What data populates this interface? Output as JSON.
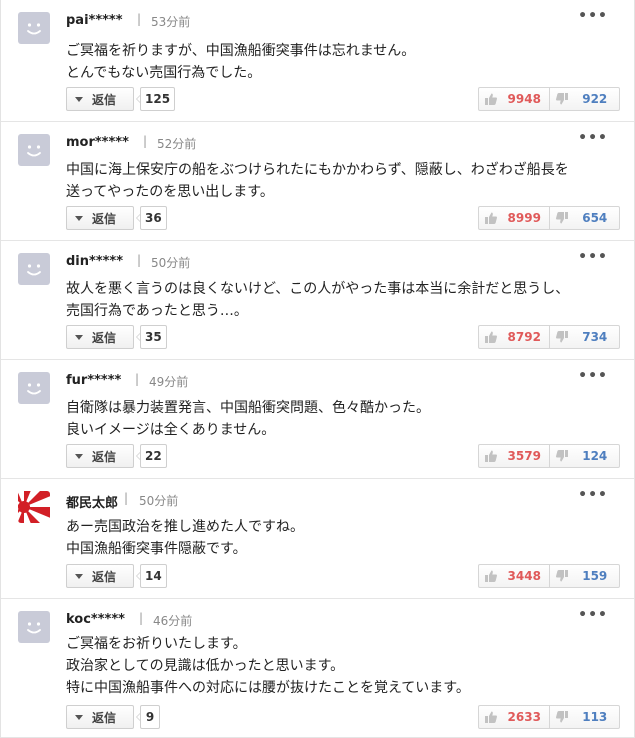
{
  "colors": {
    "like": "#e05a5a",
    "dislike": "#4f7fbf",
    "avatar_default": "#c9cbd8"
  },
  "ui": {
    "reply_label": "返信",
    "more_label": "•••",
    "separator": "|"
  },
  "comments": [
    {
      "username": "pai*****",
      "time": "53分前",
      "avatar": "default-face-icon",
      "lines": [
        "ご冥福を祈りますが、中国漁船衝突事件は忘れません。",
        "とんでもない売国行為でした。"
      ],
      "replies": "125",
      "likes": "9948",
      "dislikes": "922"
    },
    {
      "username": "mor*****",
      "time": "52分前",
      "avatar": "default-face-icon",
      "lines": [
        "中国に海上保安庁の船をぶつけられたにもかかわらず、隠蔽し、わざわざ船長を",
        "送ってやったのを思い出します。"
      ],
      "replies": "36",
      "likes": "8999",
      "dislikes": "654"
    },
    {
      "username": "din*****",
      "time": "50分前",
      "avatar": "default-face-icon",
      "lines": [
        "故人を悪く言うのは良くないけど、この人がやった事は本当に余計だと思うし、",
        "売国行為であったと思う…。"
      ],
      "replies": "35",
      "likes": "8792",
      "dislikes": "734"
    },
    {
      "username": "fur*****",
      "time": "49分前",
      "avatar": "default-face-icon",
      "lines": [
        "自衛隊は暴力装置発言、中国船衝突問題、色々酷かった。",
        "良いイメージは全くありません。"
      ],
      "replies": "22",
      "likes": "3579",
      "dislikes": "124"
    },
    {
      "username": "都民太郎",
      "time": "50分前",
      "avatar": "rising-sun-flag-icon",
      "lines": [
        "あー売国政治を推し進めた人ですね。",
        "中国漁船衝突事件隠蔽です。"
      ],
      "replies": "14",
      "likes": "3448",
      "dislikes": "159"
    },
    {
      "username": "koc*****",
      "time": "46分前",
      "avatar": "default-face-icon",
      "lines": [
        "ご冥福をお祈りいたします。",
        "政治家としての見識は低かったと思います。",
        "特に中国漁船事件への対応には腰が抜けたことを覚えています。"
      ],
      "replies": "9",
      "likes": "2633",
      "dislikes": "113"
    }
  ]
}
